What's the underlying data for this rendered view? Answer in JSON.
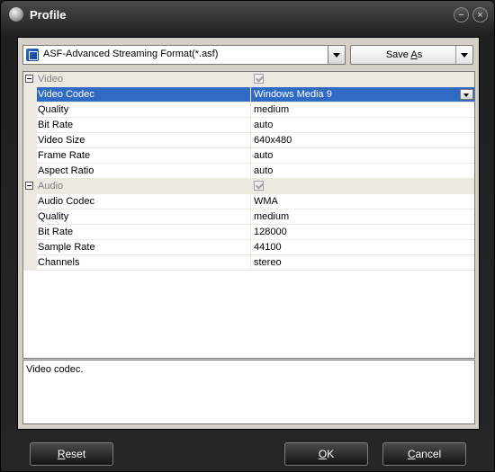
{
  "window": {
    "title": "Profile"
  },
  "titlebar": {
    "minimize_glyph": "−",
    "close_glyph": "×"
  },
  "format": {
    "selected": "ASF-Advanced Streaming Format(*.asf)",
    "icon": "asf-format-icon"
  },
  "save_as": {
    "label_pre": "Save ",
    "label_key": "A",
    "label_post": "s"
  },
  "properties": {
    "video": {
      "category": "Video",
      "rows": [
        {
          "name": "Video Codec",
          "value": "Windows Media 9"
        },
        {
          "name": "Quality",
          "value": "medium"
        },
        {
          "name": "Bit Rate",
          "value": "auto"
        },
        {
          "name": "Video Size",
          "value": "640x480"
        },
        {
          "name": "Frame Rate",
          "value": "auto"
        },
        {
          "name": "Aspect Ratio",
          "value": "auto"
        }
      ]
    },
    "audio": {
      "category": "Audio",
      "rows": [
        {
          "name": "Audio Codec",
          "value": "WMA"
        },
        {
          "name": "Quality",
          "value": "medium"
        },
        {
          "name": "Bit Rate",
          "value": "128000"
        },
        {
          "name": "Sample Rate",
          "value": "44100"
        },
        {
          "name": "Channels",
          "value": "stereo"
        }
      ]
    }
  },
  "description": "Video codec.",
  "buttons": {
    "reset": {
      "key": "R",
      "rest": "eset"
    },
    "ok": {
      "key": "O",
      "rest": "K"
    },
    "cancel": {
      "key": "C",
      "rest": "ancel"
    }
  }
}
